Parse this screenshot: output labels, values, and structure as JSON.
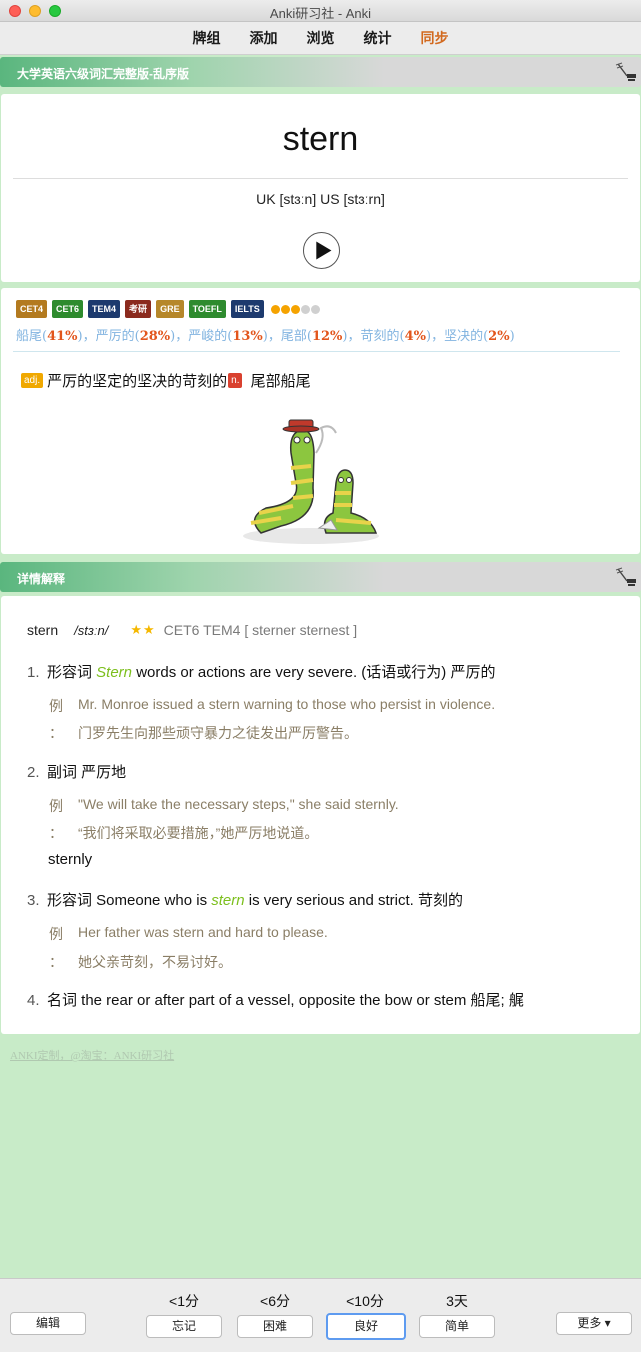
{
  "window": {
    "title": "Anki研习社 - Anki"
  },
  "toolbar": {
    "items": [
      "牌组",
      "添加",
      "浏览",
      "统计",
      "同步"
    ]
  },
  "deck_bar": {
    "label": "大学英语六级词汇完整版-乱序版",
    "icon": "broom-icon"
  },
  "word_card": {
    "word": "stern",
    "phonetic": "UK [stɜːn] US [stɜːrn]",
    "play_icon": "play-icon"
  },
  "meaning_card": {
    "badges": [
      {
        "label": "CET4",
        "color": "#b37a1f"
      },
      {
        "label": "CET6",
        "color": "#2e8b2e"
      },
      {
        "label": "TEM4",
        "color": "#1d3a6e"
      },
      {
        "label": "考研",
        "color": "#8b2a1e"
      },
      {
        "label": "GRE",
        "color": "#b6872a"
      },
      {
        "label": "TOEFL",
        "color": "#2e8b2e"
      },
      {
        "label": "IELTS",
        "color": "#1d3a6e"
      }
    ],
    "rating": {
      "filled": 3,
      "total": 5
    },
    "frequency": [
      {
        "word": "船尾",
        "pct": "41%"
      },
      {
        "word": "严厉的",
        "pct": "28%"
      },
      {
        "word": "严峻的",
        "pct": "13%"
      },
      {
        "word": "尾部",
        "pct": "12%"
      },
      {
        "word": "苛刻的",
        "pct": "4%"
      },
      {
        "word": "坚决的",
        "pct": "2%"
      }
    ],
    "pos_adj_tag": "adj.",
    "pos_adj_text": "严厉的坚定的坚决的苛刻的",
    "pos_n_tag": "n.",
    "pos_n_text": " 尾部船尾"
  },
  "detail_bar": {
    "label": "详情解释"
  },
  "detail": {
    "headword": "stern",
    "phonetic": "/stɜːn/",
    "stars": "★★",
    "tags": "CET6 TEM4 [ sterner sternest ]",
    "senses": [
      {
        "num": "1.",
        "pre": "形容词 ",
        "hl": "Stern",
        "post": " words or actions are very severe. (话语或行为) 严厉的",
        "ex_en": "Mr. Monroe issued a stern warning to those who persist in violence.",
        "ex_zh": "门罗先生向那些顽守暴力之徒发出严厉警告。"
      },
      {
        "num": "2.",
        "pre": "副词 严厉地",
        "hl": "",
        "post": "",
        "ex_en": "\"We will take the necessary steps,\" she said sternly.",
        "ex_zh": "“我们将采取必要措施，”她严厉地说道。"
      },
      {
        "num": "3.",
        "pre": "形容词 Someone who is ",
        "hl": "stern",
        "post": " is very serious and strict. 苛刻的",
        "ex_en": "Her father was stern and hard to please.",
        "ex_zh": "她父亲苛刻，不易讨好。"
      },
      {
        "num": "4.",
        "pre": "名词 the rear or after part of a vessel, opposite the bow or stem 船尾; 艉",
        "hl": "",
        "post": ""
      }
    ],
    "derived": "sternly",
    "ex_label": "例",
    "ex_colon": "："
  },
  "footer": {
    "link": "ANKI定制，@淘宝：ANKI研习社"
  },
  "answer_bar": {
    "edit": "编辑",
    "more": "更多 ▾",
    "intervals": [
      "<1分",
      "<6分",
      "<10分",
      "3天"
    ],
    "buttons": [
      "忘记",
      "困难",
      "良好",
      "简单"
    ]
  }
}
